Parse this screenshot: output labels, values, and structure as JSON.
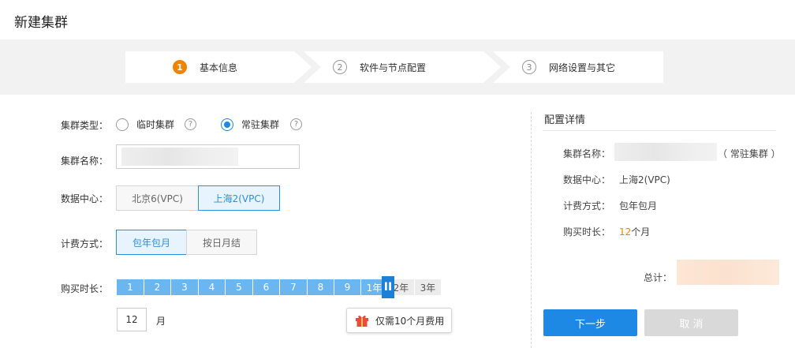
{
  "page": {
    "title": "新建集群"
  },
  "steps": [
    {
      "num": "1",
      "label": "基本信息",
      "active": true
    },
    {
      "num": "2",
      "label": "软件与节点配置",
      "active": false
    },
    {
      "num": "3",
      "label": "网络设置与其它",
      "active": false
    }
  ],
  "form": {
    "cluster_type": {
      "label": "集群类型：",
      "options": [
        {
          "label": "临时集群",
          "checked": false
        },
        {
          "label": "常驻集群",
          "checked": true
        }
      ],
      "help": "?"
    },
    "cluster_name": {
      "label": "集群名称：",
      "value": ""
    },
    "datacenter": {
      "label": "数据中心：",
      "options": [
        {
          "label": "北京6(VPC)",
          "active": false
        },
        {
          "label": "上海2(VPC)",
          "active": true
        }
      ]
    },
    "billing": {
      "label": "计费方式：",
      "options": [
        {
          "label": "包年包月",
          "active": true
        },
        {
          "label": "按日月结",
          "active": false
        }
      ]
    },
    "duration": {
      "label": "购买时长：",
      "ticks": [
        "1",
        "2",
        "3",
        "4",
        "5",
        "6",
        "7",
        "8",
        "9",
        "1年",
        "2年",
        "3年"
      ],
      "selected_index": 9,
      "handle_glyph": "II",
      "months_value": "12",
      "months_unit": "月",
      "promo_text": "仅需10个月费用"
    }
  },
  "summary": {
    "title": "配置详情",
    "name_label": "集群名称：",
    "name_value": "",
    "name_suffix": "（ 常驻集群 ）",
    "dc_label": "数据中心：",
    "dc_value": "上海2(VPC)",
    "billing_label": "计费方式：",
    "billing_value": "包年包月",
    "duration_label": "购买时长：",
    "duration_number": "12",
    "duration_unit": "个月",
    "total_label": "总计：",
    "total_value": ""
  },
  "buttons": {
    "next": "下一步",
    "cancel": "取 消"
  },
  "colors": {
    "accent": "#1e88e5",
    "step_active": "#f08300",
    "slider_fill": "#6cb6ef"
  }
}
